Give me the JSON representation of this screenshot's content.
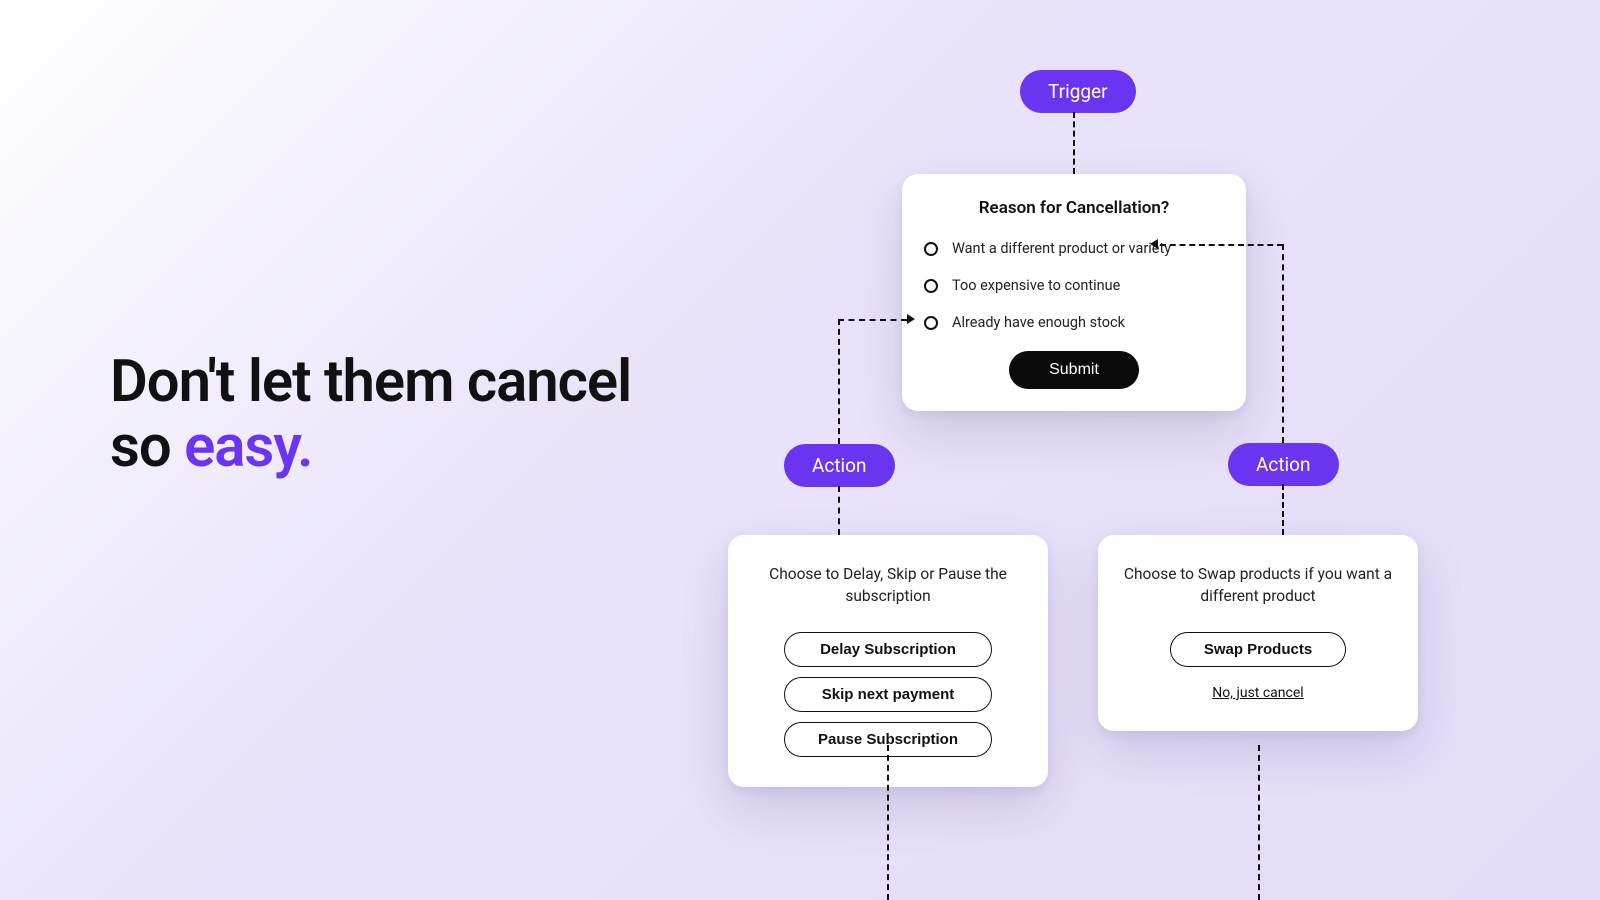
{
  "headline": {
    "line1_pre": "Don't let them cancel",
    "line2_pre": "so ",
    "line2_accent": "easy."
  },
  "trigger_label": "Trigger",
  "action_label_left": "Action",
  "action_label_right": "Action",
  "reason_card": {
    "title": "Reason for Cancellation?",
    "options": [
      "Want a different product or variety",
      "Too expensive to continue",
      "Already have enough stock"
    ],
    "submit": "Submit"
  },
  "left_card": {
    "text": "Choose to Delay, Skip or Pause the subscription",
    "buttons": [
      "Delay Subscription",
      "Skip next payment",
      "Pause Subscription"
    ]
  },
  "right_card": {
    "text": "Choose to Swap products if you want a different product",
    "button": "Swap Products",
    "link": "No, just cancel"
  }
}
